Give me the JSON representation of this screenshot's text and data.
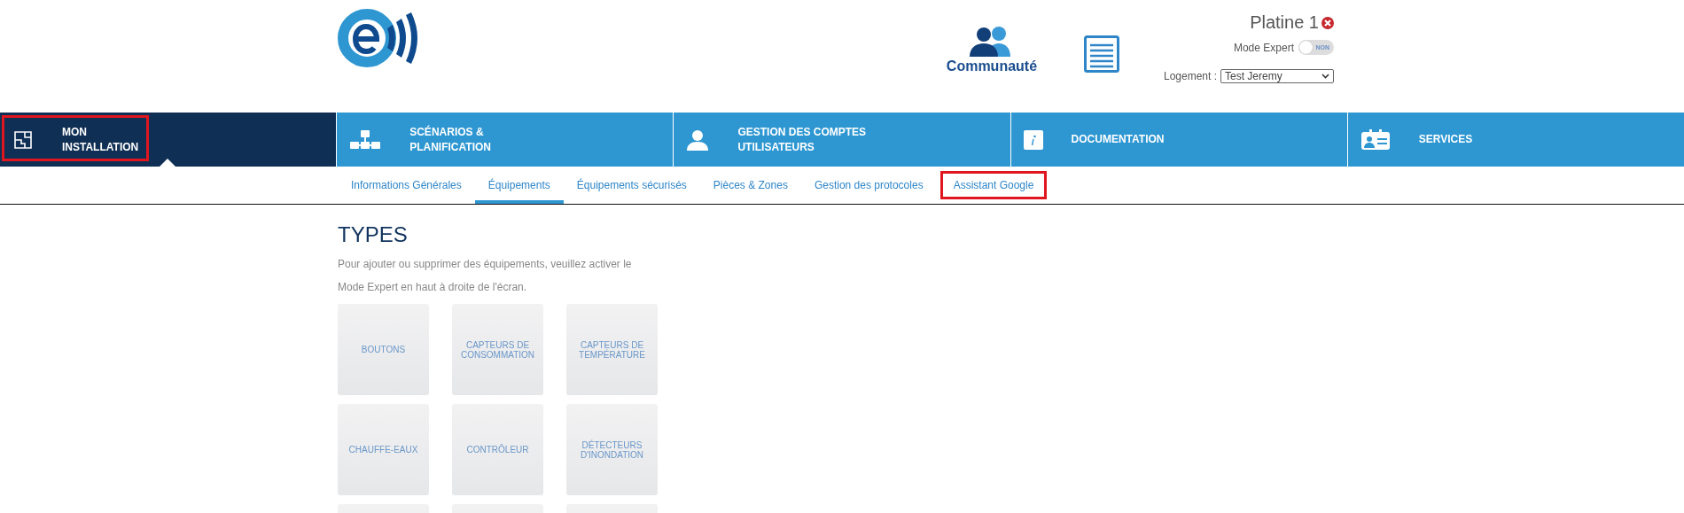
{
  "header": {
    "community_label": "Communauté",
    "site_name": "Platine 1",
    "expert_mode": {
      "label": "Mode Expert",
      "on": false,
      "state_text": "NON"
    },
    "housing": {
      "label": "Logement :",
      "value": "Test Jeremy"
    }
  },
  "main_nav": [
    {
      "label": "MON\nINSTALLATION",
      "kind": "install",
      "selected": true,
      "highlighted": true
    },
    {
      "label": "SCÉNARIOS &\nPLANIFICATION",
      "kind": "scenario",
      "selected": false,
      "highlighted": false
    },
    {
      "label": "GESTION DES COMPTES\nUTILISATEURS",
      "kind": "user",
      "selected": false,
      "highlighted": false
    },
    {
      "label": "DOCUMENTATION",
      "kind": "info",
      "selected": false,
      "highlighted": false
    },
    {
      "label": "SERVICES",
      "kind": "badge",
      "selected": false,
      "highlighted": false
    }
  ],
  "sub_nav": [
    {
      "label": "Informations Générales",
      "selected": false,
      "highlighted": false
    },
    {
      "label": "Équipements",
      "selected": true,
      "highlighted": false
    },
    {
      "label": "Équipements sécurisés",
      "selected": false,
      "highlighted": false
    },
    {
      "label": "Pièces & Zones",
      "selected": false,
      "highlighted": false
    },
    {
      "label": "Gestion des protocoles",
      "selected": false,
      "highlighted": false
    },
    {
      "label": "Assistant Google",
      "selected": false,
      "highlighted": true
    }
  ],
  "content": {
    "title": "TYPES",
    "notice_lines": [
      "Pour ajouter ou supprimer des équipements, veuillez activer le",
      "Mode Expert en haut à droite de l'écran."
    ],
    "tiles": [
      {
        "kind": "labeled",
        "label": "BOUTONS"
      },
      {
        "kind": "labeled",
        "label": "CAPTEURS DE\nCONSOMMATION"
      },
      {
        "kind": "labeled",
        "label": "CAPTEURS DE\nTEMPÉRATURE"
      },
      {
        "kind": "labeled",
        "label": "CHAUFFE-EAUX"
      },
      {
        "kind": "labeled",
        "label": "CONTRÔLEUR"
      },
      {
        "kind": "labeled",
        "label": "DÉTECTEURS\nD'INONDATION"
      },
      {
        "kind": "cut"
      },
      {
        "kind": "cut"
      },
      {
        "kind": "cut"
      }
    ]
  }
}
